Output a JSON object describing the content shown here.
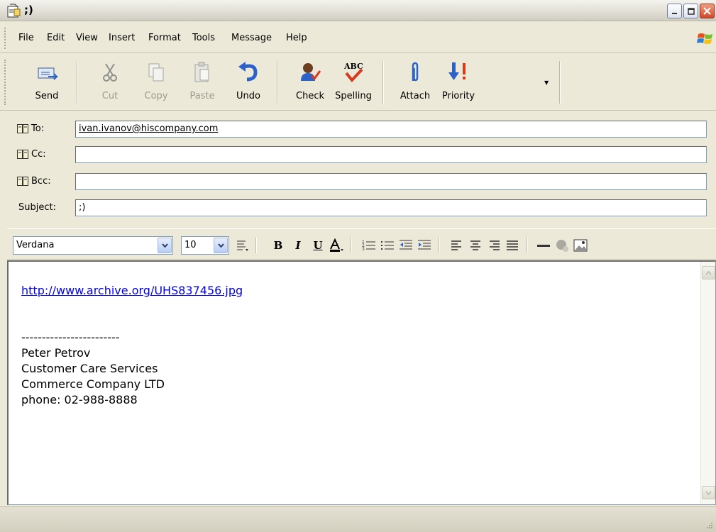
{
  "window": {
    "title": ";)",
    "icons": {
      "app": "compose-message-icon",
      "minimize": "minimize-icon",
      "maximize": "maximize-icon",
      "close": "close-icon"
    }
  },
  "menu": {
    "items": [
      "File",
      "Edit",
      "View",
      "Insert",
      "Format",
      "Tools",
      "Message",
      "Help"
    ],
    "logo": "windows-logo-icon"
  },
  "toolbar": {
    "buttons": [
      {
        "label": "Send",
        "icon": "send-icon",
        "enabled": true
      },
      {
        "label": "Cut",
        "icon": "scissors-icon",
        "enabled": false
      },
      {
        "label": "Copy",
        "icon": "copy-icon",
        "enabled": false
      },
      {
        "label": "Paste",
        "icon": "paste-icon",
        "enabled": false
      },
      {
        "label": "Undo",
        "icon": "undo-icon",
        "enabled": true
      },
      {
        "label": "Check",
        "icon": "check-names-icon",
        "enabled": true
      },
      {
        "label": "Spelling",
        "icon": "spelling-icon",
        "enabled": true
      },
      {
        "label": "Attach",
        "icon": "paperclip-icon",
        "enabled": true
      },
      {
        "label": "Priority",
        "icon": "priority-icon",
        "enabled": true
      }
    ]
  },
  "fields": {
    "to": {
      "label": "To:",
      "value": "ivan.ivanov@hiscompany.com"
    },
    "cc": {
      "label": "Cc:",
      "value": ""
    },
    "bcc": {
      "label": "Bcc:",
      "value": ""
    },
    "subject": {
      "label": "Subject:",
      "value": ";)"
    }
  },
  "format": {
    "font_family": "Verdana",
    "font_size": "10",
    "buttons": [
      "paragraph-style-icon",
      "bold-icon",
      "italic-icon",
      "underline-icon",
      "font-color-icon",
      "numbered-list-icon",
      "bulleted-list-icon",
      "decrease-indent-icon",
      "increase-indent-icon",
      "align-left-icon",
      "align-center-icon",
      "align-right-icon",
      "justify-icon",
      "horizontal-line-icon",
      "insert-hyperlink-icon",
      "insert-picture-icon"
    ]
  },
  "message": {
    "link": "http://www.archive.org/UHS837456.jpg",
    "separator": "------------------------",
    "signature": [
      "Peter Petrov",
      "Customer Care Services",
      "Commerce Company LTD",
      "phone: 02-988-8888"
    ]
  },
  "colors": {
    "link": "#0000ee",
    "chrome": "#ece9d8",
    "accent": "#e03c1a"
  }
}
